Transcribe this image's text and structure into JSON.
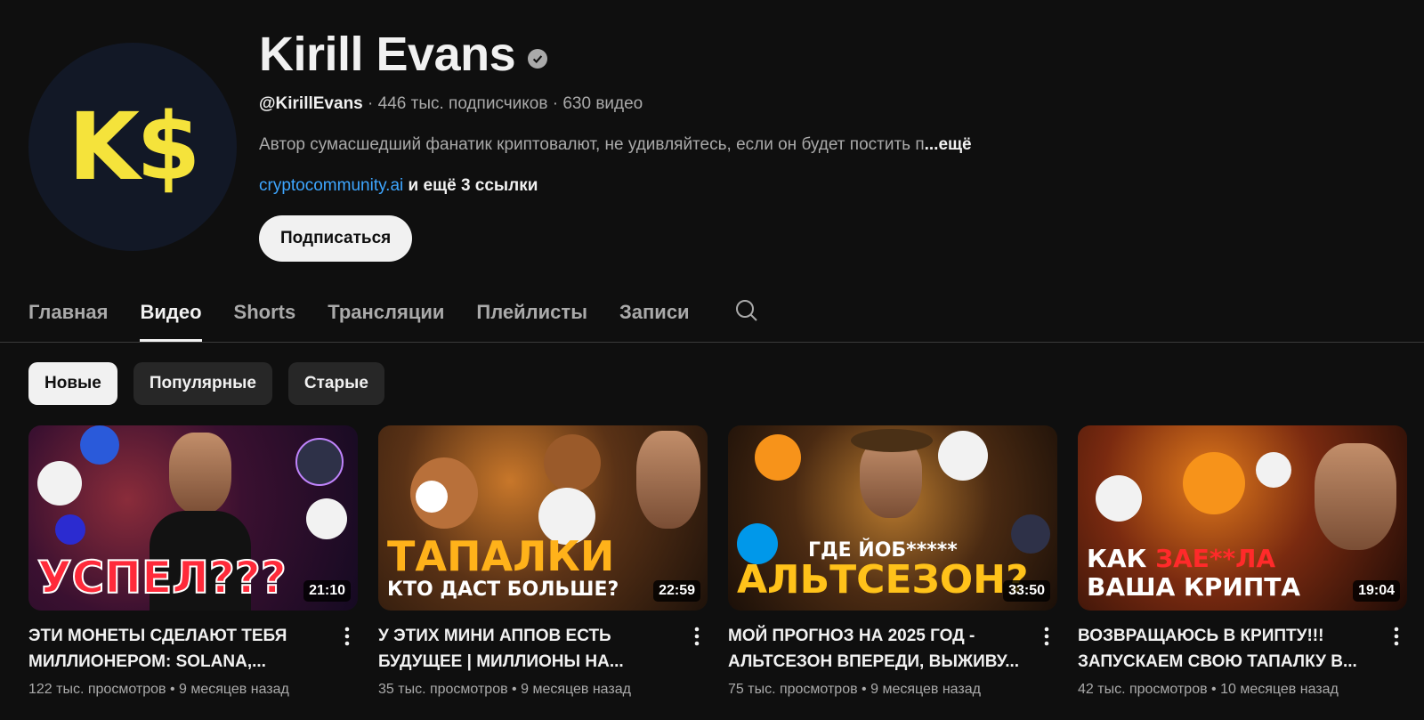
{
  "channel": {
    "avatar_text": "K$",
    "name": "Kirill Evans",
    "handle": "@KirillEvans",
    "subscribers": "446 тыс. подписчиков",
    "videos_count": "630 видео",
    "separator": " · ",
    "description": "Автор сумасшедший фанатик криптовалют, не удивляйтесь, если он будет постить п",
    "more_label": "...ещё",
    "link": "cryptocommunity.ai",
    "more_links": "и ещё 3 ссылки",
    "subscribe_label": "Подписаться"
  },
  "tabs": [
    {
      "label": "Главная"
    },
    {
      "label": "Видео"
    },
    {
      "label": "Shorts"
    },
    {
      "label": "Трансляции"
    },
    {
      "label": "Плейлисты"
    },
    {
      "label": "Записи"
    }
  ],
  "active_tab": "Видео",
  "chips": [
    {
      "label": "Новые"
    },
    {
      "label": "Популярные"
    },
    {
      "label": "Старые"
    }
  ],
  "videos": [
    {
      "thumb_text": "УСПЕЛ???",
      "duration": "21:10",
      "title_line1": "ЭТИ МОНЕТЫ СДЕЛАЮТ ТЕБЯ",
      "title_line2": "МИЛЛИОНЕРОМ: SOLANA,...",
      "views": "122 тыс. просмотров",
      "age": "9 месяцев назад"
    },
    {
      "thumb_text_a": "ТАПАЛКИ",
      "thumb_text_b": "КТО ДАСТ БОЛЬШЕ?",
      "duration": "22:59",
      "title_line1": "У ЭТИХ МИНИ АППОВ ЕСТЬ",
      "title_line2": "БУДУЩЕЕ | МИЛЛИОНЫ НА...",
      "views": "35 тыс. просмотров",
      "age": "9 месяцев назад"
    },
    {
      "thumb_text_a": "ГДЕ ЙОБ*****",
      "thumb_text_b": "АЛЬТСЕЗОН?",
      "duration": "33:50",
      "title_line1": "МОЙ ПРОГНОЗ НА 2025 ГОД -",
      "title_line2": "АЛЬТСЕЗОН ВПЕРЕДИ, ВЫЖИВУ...",
      "views": "75 тыс. просмотров",
      "age": "9 месяцев назад"
    },
    {
      "thumb_text_a1": "КАК ",
      "thumb_text_a2": "ЗАЕ**ЛА",
      "thumb_text_b": "ВАША КРИПТА",
      "duration": "19:04",
      "title_line1": "ВОЗВРАЩАЮСЬ В КРИПТУ!!!",
      "title_line2": "ЗАПУСКАЕМ СВОЮ ТАПАЛКУ В...",
      "views": "42 тыс. просмотров",
      "age": "10 месяцев назад"
    }
  ],
  "meta_separator": " • ",
  "icons": {
    "verified": "verified-check-icon",
    "search": "search-icon",
    "kebab": "more-vert-icon"
  },
  "colors": {
    "background": "#0f0f0f",
    "link": "#3ea6ff",
    "avatar_text": "#f5e33b"
  }
}
